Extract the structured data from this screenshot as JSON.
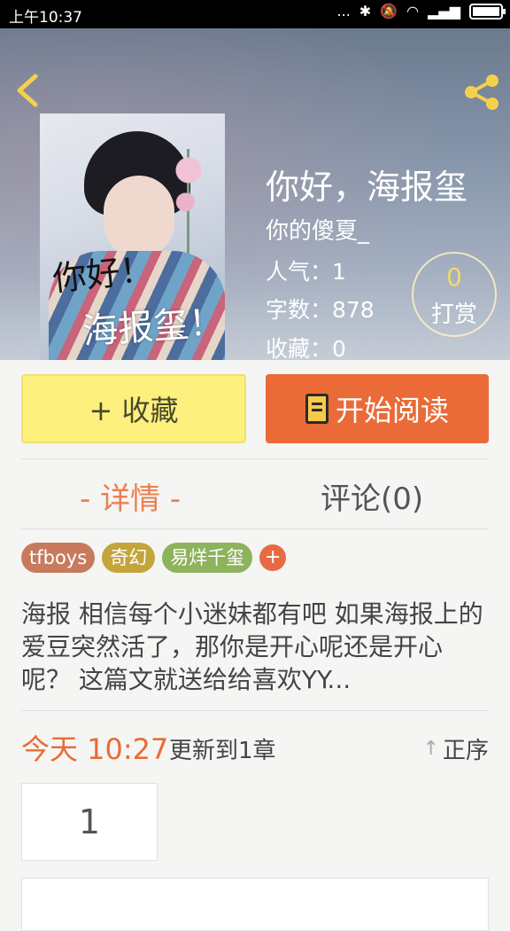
{
  "status_bar": {
    "time": "上午10:37",
    "dots": "...",
    "signal": "▂▄▆"
  },
  "book": {
    "title": "你好，海报玺",
    "author": "你的傻夏_",
    "popularity": "人气：1",
    "word_count": "字数：878",
    "favorites": "收藏：0",
    "reward_count": "0",
    "reward_label": "打赏",
    "cover_text_1": "你好！",
    "cover_text_2": "海报玺！"
  },
  "actions": {
    "favorite": "+ 收藏",
    "read": "开始阅读"
  },
  "tabs": {
    "detail": "- 详情 -",
    "comments": "评论(0)"
  },
  "tags": [
    {
      "label": "tfboys",
      "color": "#c87a5d"
    },
    {
      "label": "奇幻",
      "color": "#c4a53c"
    },
    {
      "label": "易烊千玺",
      "color": "#8db35c"
    }
  ],
  "tag_add": "+",
  "description": "海报 相信每个小迷妹都有吧  如果海报上的爱豆突然活了，那你是开心呢还是开心呢？  这篇文就送给给喜欢YY...",
  "update": {
    "today": "今天 10:27",
    "text": "更新到1章",
    "sort": "正序"
  },
  "chapters": {
    "first_number": "1"
  },
  "colors": {
    "accent": "#ea6b37",
    "favorite_bg": "#fdf07f",
    "tab_active": "#ea8050"
  }
}
